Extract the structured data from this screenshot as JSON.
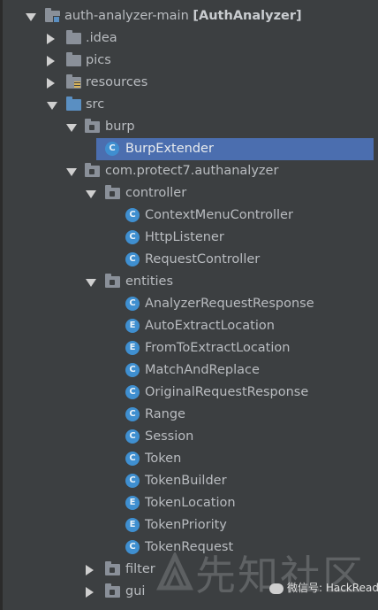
{
  "tree": {
    "root": {
      "name": "auth-analyzer-main",
      "module": "[AuthAnalyzer]"
    },
    "idea": ".idea",
    "pics": "pics",
    "resources": "resources",
    "src": "src",
    "burp": "burp",
    "burp_extender": "BurpExtender",
    "package": "com.protect7.authanalyzer",
    "controller": "controller",
    "controller_classes": [
      "ContextMenuController",
      "HttpListener",
      "RequestController"
    ],
    "entities": "entities",
    "entities_classes": [
      {
        "name": "AnalyzerRequestResponse",
        "icon": "C"
      },
      {
        "name": "AutoExtractLocation",
        "icon": "E"
      },
      {
        "name": "FromToExtractLocation",
        "icon": "E"
      },
      {
        "name": "MatchAndReplace",
        "icon": "C"
      },
      {
        "name": "OriginalRequestResponse",
        "icon": "C"
      },
      {
        "name": "Range",
        "icon": "C"
      },
      {
        "name": "Session",
        "icon": "C"
      },
      {
        "name": "Token",
        "icon": "C"
      },
      {
        "name": "TokenBuilder",
        "icon": "C"
      },
      {
        "name": "TokenLocation",
        "icon": "E"
      },
      {
        "name": "TokenPriority",
        "icon": "E"
      },
      {
        "name": "TokenRequest",
        "icon": "C"
      }
    ],
    "filter": "filter",
    "gui": "gui"
  },
  "watermark": {
    "text": "先知社区",
    "badge": "微信号: HackRead"
  },
  "colors": {
    "background": "#3c3f41",
    "selection": "#4b6eaf",
    "class_icon": "#3f8fd0",
    "text": "#b9bcc0"
  }
}
